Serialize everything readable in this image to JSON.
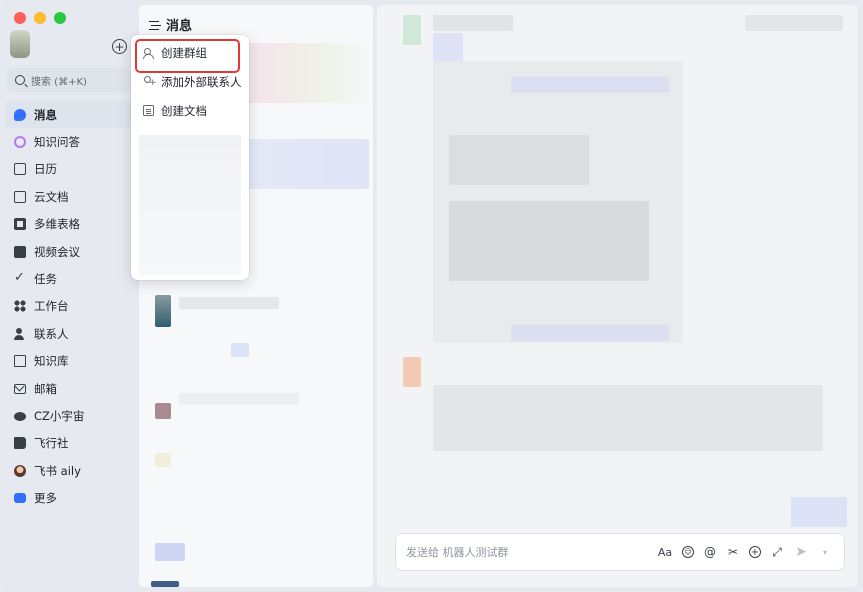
{
  "sidebar": {
    "search_placeholder": "搜索 (⌘+K)",
    "items": [
      {
        "label": "消息",
        "icon": "message-icon",
        "active": true
      },
      {
        "label": "知识问答",
        "icon": "knowledge-qa-icon"
      },
      {
        "label": "日历",
        "icon": "calendar-icon"
      },
      {
        "label": "云文档",
        "icon": "cloud-doc-icon"
      },
      {
        "label": "多维表格",
        "icon": "base-table-icon"
      },
      {
        "label": "视频会议",
        "icon": "video-meeting-icon"
      },
      {
        "label": "任务",
        "icon": "task-check-icon"
      },
      {
        "label": "工作台",
        "icon": "workplace-grid-icon"
      },
      {
        "label": "联系人",
        "icon": "contacts-icon"
      },
      {
        "label": "知识库",
        "icon": "wiki-icon"
      },
      {
        "label": "邮箱",
        "icon": "mail-icon"
      },
      {
        "label": "CZ小宇宙",
        "icon": "planet-icon"
      },
      {
        "label": "飞行社",
        "icon": "book-icon"
      },
      {
        "label": "飞书 aily",
        "icon": "aily-avatar-icon"
      },
      {
        "label": "更多",
        "icon": "more-apps-icon"
      }
    ]
  },
  "middle": {
    "title": "消息"
  },
  "menu": {
    "items": [
      {
        "label": "创建群组",
        "icon": "create-group-icon",
        "highlighted": true
      },
      {
        "label": "添加外部联系人",
        "icon": "add-external-contact-icon"
      },
      {
        "label": "创建文档",
        "icon": "create-doc-icon"
      }
    ]
  },
  "chat": {
    "composer_placeholder": "发送给 机器人测试群",
    "tools": {
      "format": "Aa",
      "emoji": "☺",
      "mention": "@",
      "screenshot": "✂",
      "plus": "+",
      "expand": "⤢",
      "send": "➤",
      "send_options": "▾"
    }
  },
  "colors": {
    "accent": "#3370ff",
    "highlight_border": "#e03a35",
    "sidebar_bg": "#e6e9f0",
    "panel_bg": "#f7f8fa"
  }
}
